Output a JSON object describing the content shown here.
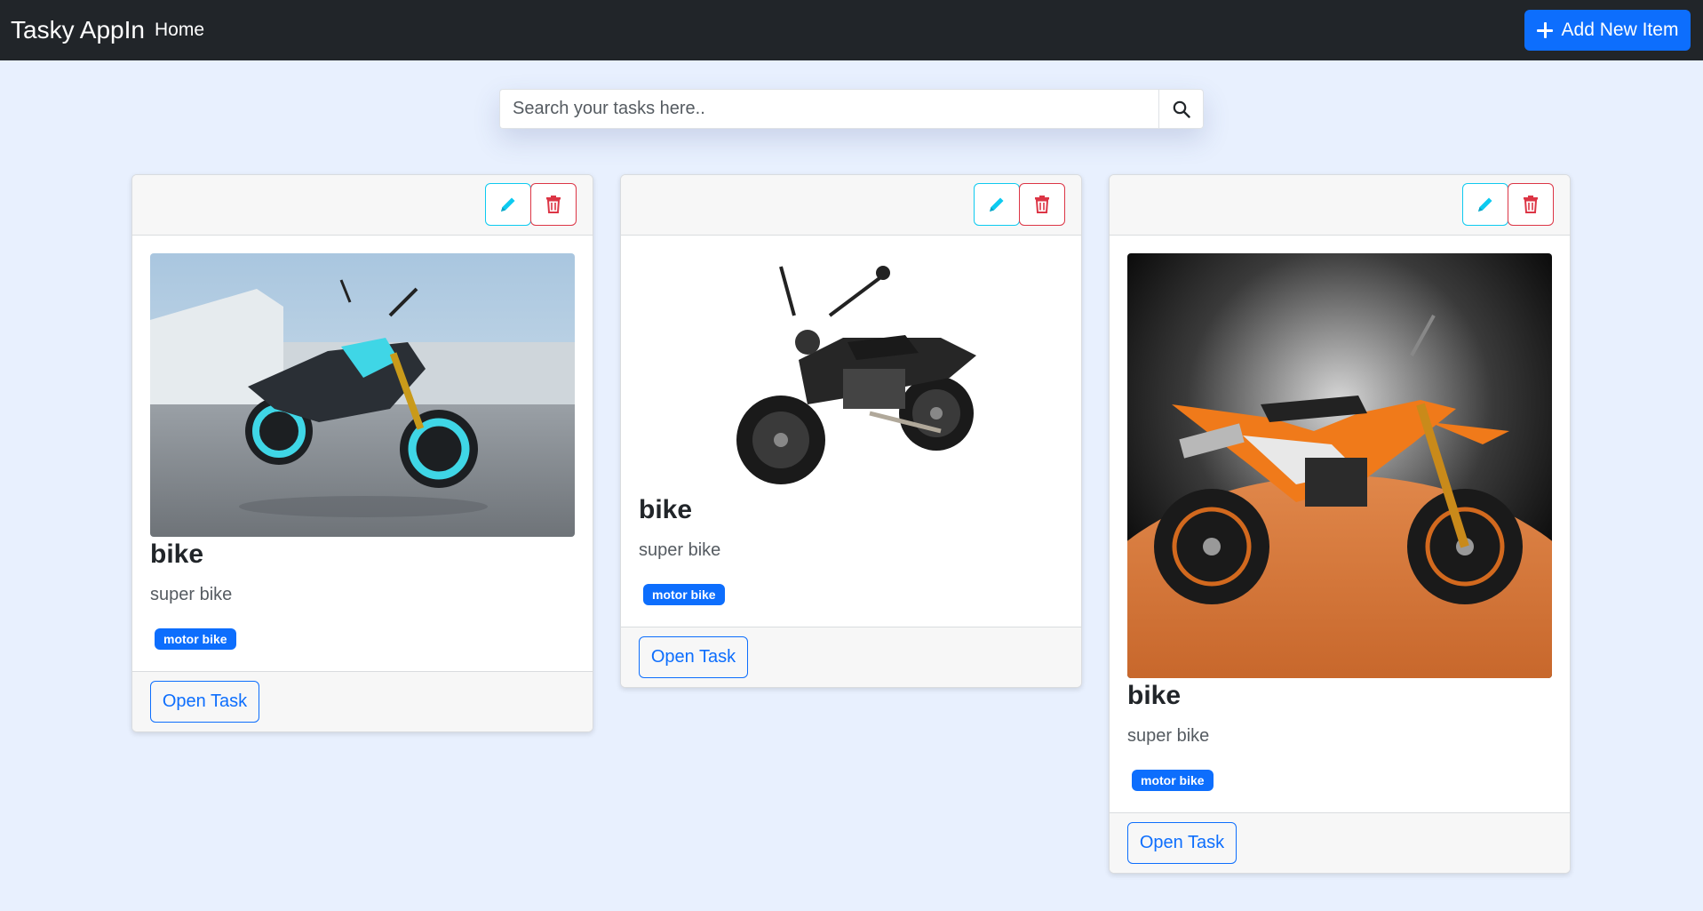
{
  "navbar": {
    "brand": "Tasky AppIn",
    "home_label": "Home",
    "add_button_label": "Add New Item"
  },
  "search": {
    "placeholder": "Search your tasks here..",
    "value": ""
  },
  "cards": [
    {
      "title": "bike",
      "description": "super bike",
      "tag": "motor bike",
      "open_label": "Open Task",
      "image": "motorcycle-photo-blue-street"
    },
    {
      "title": "bike",
      "description": "super bike",
      "tag": "motor bike",
      "open_label": "Open Task",
      "image": "motorcycle-photo-black-scrambler"
    },
    {
      "title": "bike",
      "description": "super bike",
      "tag": "motor bike",
      "open_label": "Open Task",
      "image": "motorcycle-photo-orange-dirt-bike"
    }
  ],
  "colors": {
    "navbar_bg": "#212529",
    "primary": "#0d6efd",
    "edit_outline": "#0dcaf0",
    "delete_outline": "#dc3545",
    "page_bg": "#e8f0fe"
  },
  "icons": {
    "add": "plus-icon",
    "search": "search-icon",
    "edit": "pencil-icon",
    "delete": "trash-icon"
  }
}
